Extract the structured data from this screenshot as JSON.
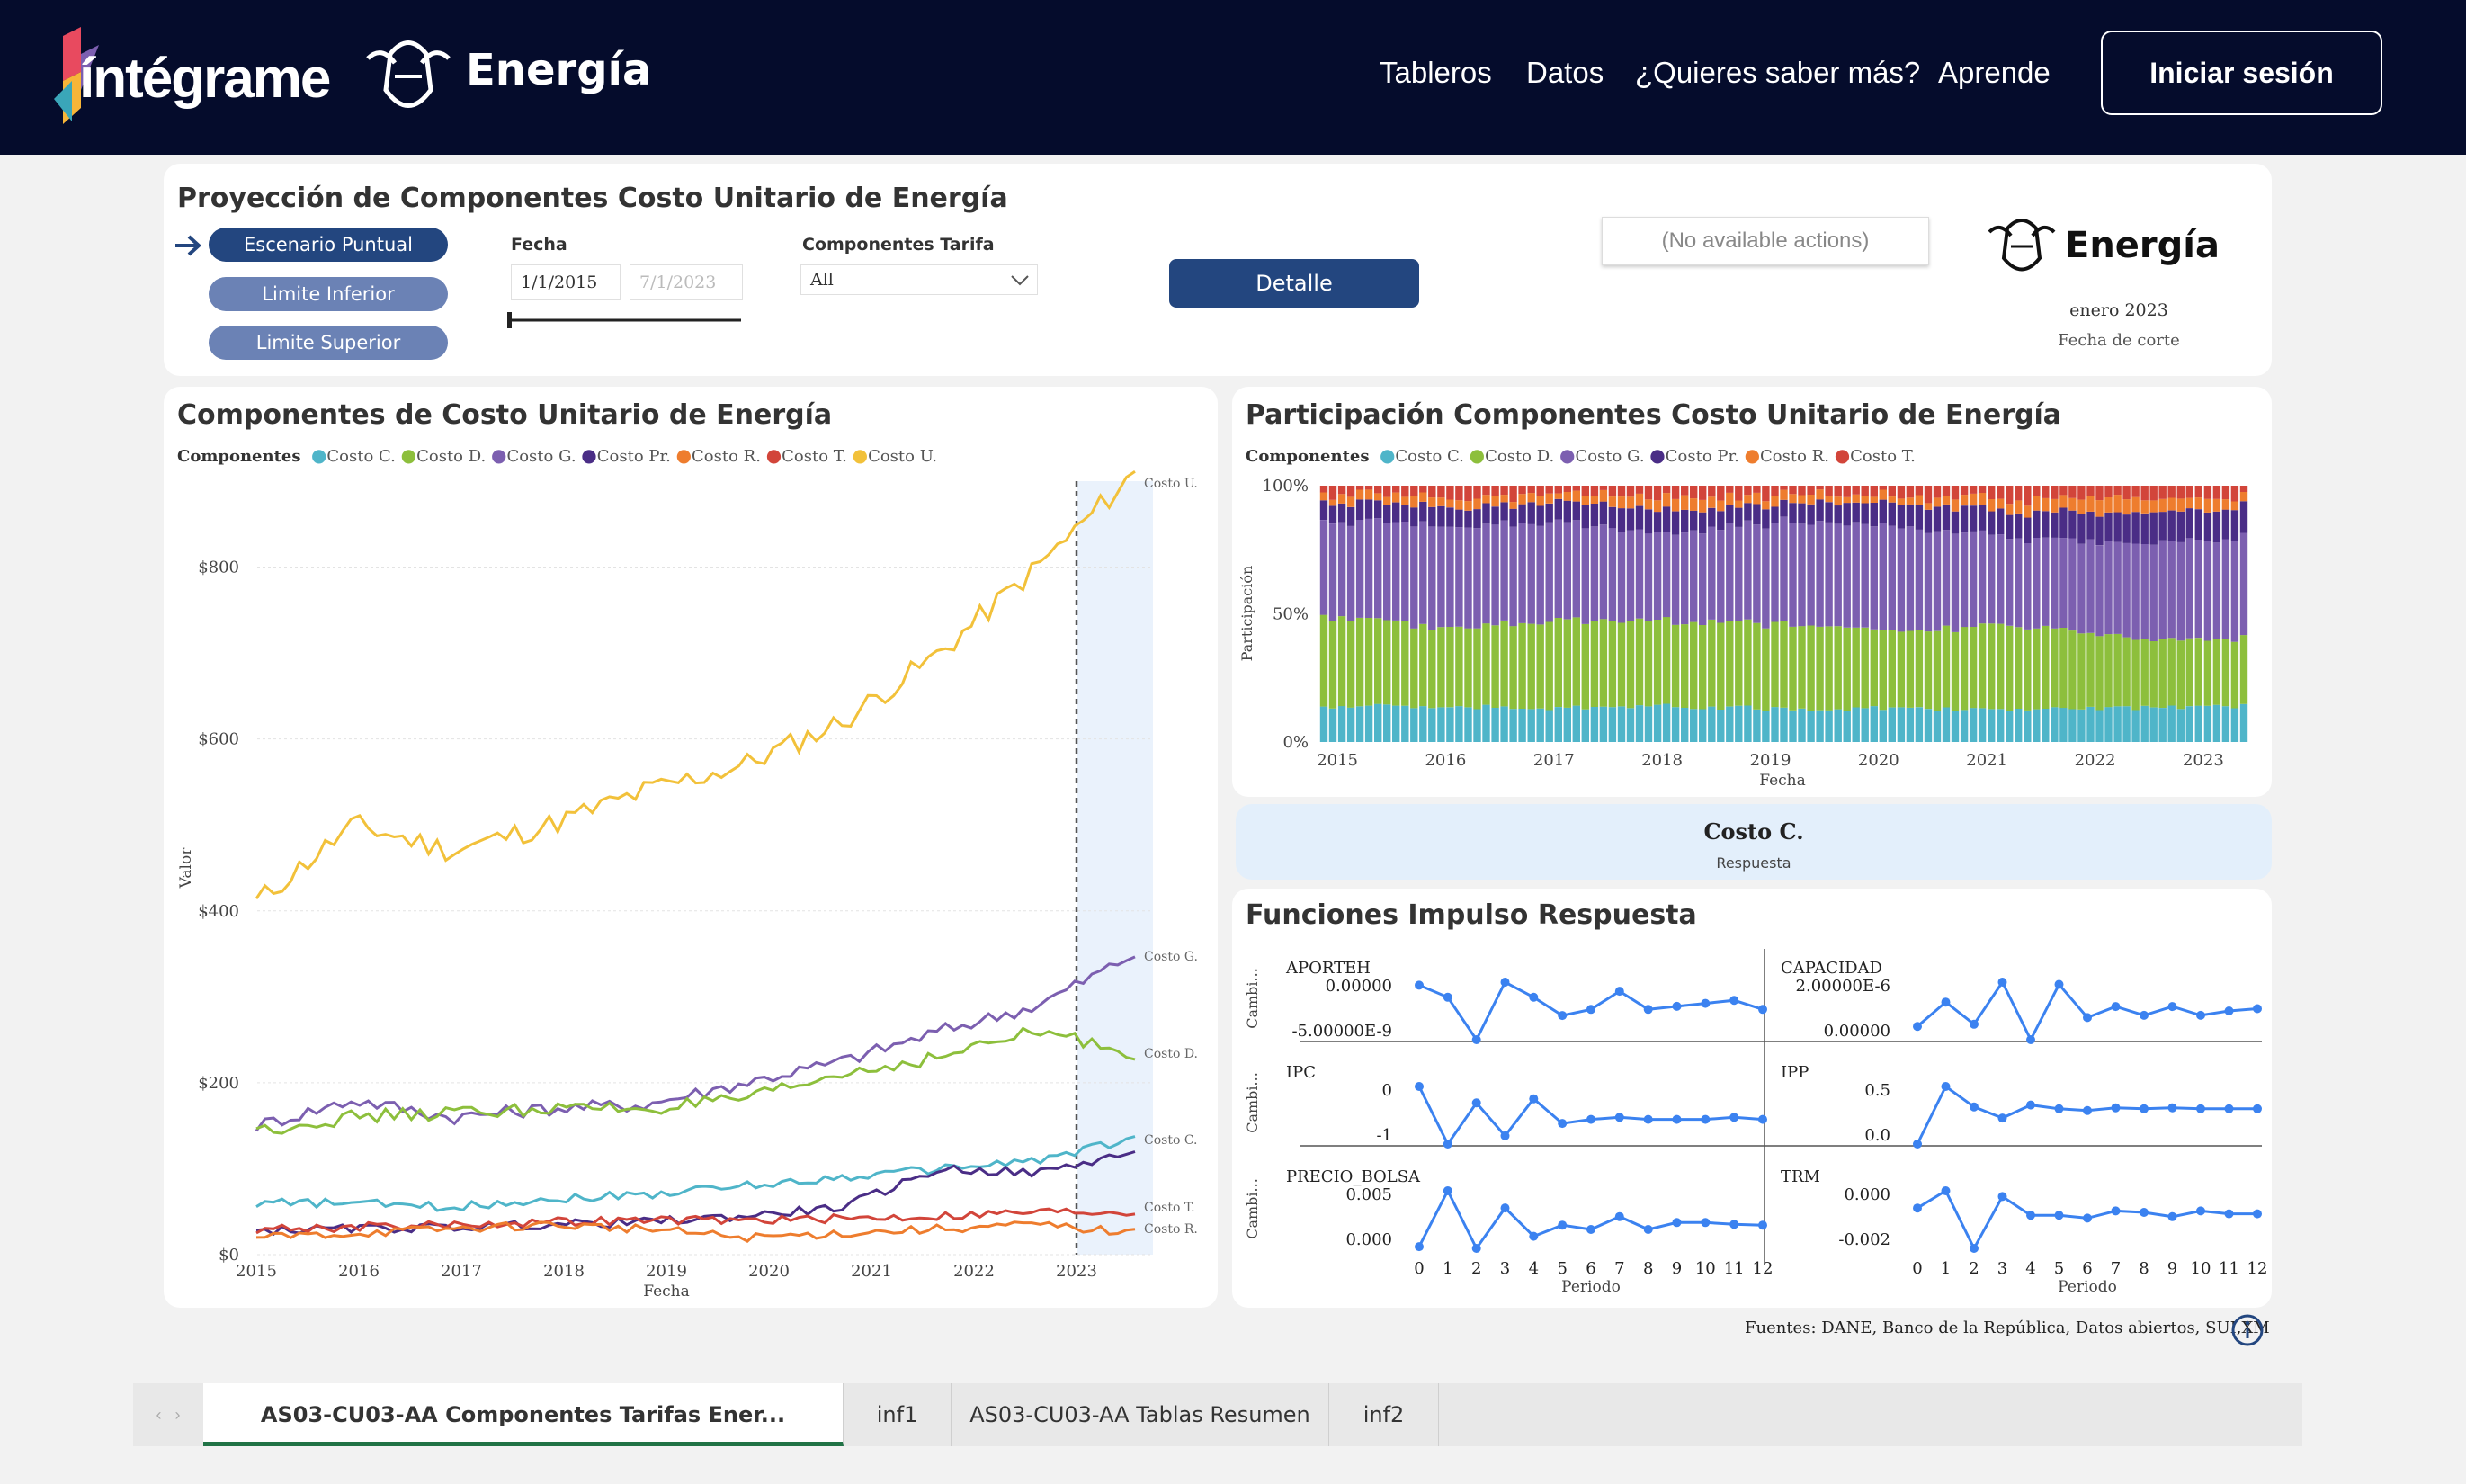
{
  "nav": {
    "logo_text": "íntégrame",
    "brand": "Energía",
    "links": [
      "Tableros",
      "Datos",
      "¿Quieres saber más?",
      "Aprende"
    ],
    "login": "Iniciar sesión"
  },
  "controls": {
    "title": "Proyección de Componentes Costo Unitario de Energía",
    "scenarios": [
      "Escenario Puntual",
      "Limite Inferior",
      "Limite Superior"
    ],
    "fecha_label": "Fecha",
    "fecha_from": "1/1/2015",
    "fecha_to": "7/1/2023",
    "componentes_label": "Componentes Tarifa",
    "componentes_value": "All",
    "detalle": "Detalle",
    "no_actions": "(No available actions)",
    "brand": "Energía",
    "fecha_corte_value": "enero 2023",
    "fecha_corte_label": "Fecha de corte"
  },
  "colors": {
    "costo_c": "#4fb5c9",
    "costo_d": "#8dbf3c",
    "costo_g": "#7c5fb0",
    "costo_pr": "#4a2d86",
    "costo_r": "#ee7d2e",
    "costo_t": "#d2453a",
    "costo_u": "#f2c13a",
    "accent": "#23467f",
    "pill_light": "#6b82b5",
    "nav_bg": "#050c2c"
  },
  "line_chart": {
    "title": "Componentes de Costo Unitario de Energía",
    "legend_title": "Componentes",
    "legend": [
      "Costo C.",
      "Costo D.",
      "Costo G.",
      "Costo Pr.",
      "Costo R.",
      "Costo T.",
      "Costo U."
    ],
    "ylabel": "Valor",
    "xlabel": "Fecha",
    "yticks": [
      "$0",
      "$200",
      "$400",
      "$600",
      "$800"
    ],
    "xticks": [
      "2015",
      "2016",
      "2017",
      "2018",
      "2019",
      "2020",
      "2021",
      "2022",
      "2023"
    ],
    "end_labels": [
      "Costo U.",
      "Costo G.",
      "Costo D.",
      "Costo C.",
      "Costo T.",
      "Costo R."
    ]
  },
  "bar_chart": {
    "title": "Participación Componentes Costo Unitario de Energía",
    "legend_title": "Componentes",
    "legend": [
      "Costo C.",
      "Costo D.",
      "Costo G.",
      "Costo Pr.",
      "Costo R.",
      "Costo T."
    ],
    "ylabel": "Participación",
    "xlabel": "Fecha",
    "yticks": [
      "0%",
      "50%",
      "100%"
    ],
    "xticks": [
      "2015",
      "2016",
      "2017",
      "2018",
      "2019",
      "2020",
      "2021",
      "2022",
      "2023"
    ]
  },
  "selected": {
    "name": "Costo C.",
    "sub": "Respuesta"
  },
  "irf": {
    "title": "Funciones Impulso Respuesta",
    "ylabel": "Cambi...",
    "xlabel": "Periodo",
    "periods": [
      "0",
      "1",
      "2",
      "3",
      "4",
      "5",
      "6",
      "7",
      "8",
      "9",
      "10",
      "11",
      "12"
    ],
    "panels": [
      {
        "name": "APORTEH",
        "ticks": [
          "0.00000",
          "-5.00000E-9"
        ]
      },
      {
        "name": "CAPACIDAD",
        "ticks": [
          "2.00000E-6",
          "0.00000"
        ]
      },
      {
        "name": "IPC",
        "ticks": [
          "0",
          "-1"
        ]
      },
      {
        "name": "IPP",
        "ticks": [
          "0.5",
          "0.0"
        ]
      },
      {
        "name": "PRECIO_BOLSA",
        "ticks": [
          "0.005",
          "0.000"
        ]
      },
      {
        "name": "TRM",
        "ticks": [
          "0.000",
          "-0.002"
        ]
      }
    ]
  },
  "footer": {
    "sources": "Fuentes: DANE, Banco de la República, Datos abiertos, SUI,XM"
  },
  "tabs": [
    "AS03-CU03-AA Componentes Tarifas Ener...",
    "inf1",
    "AS03-CU03-AA Tablas Resumen",
    "inf2"
  ],
  "chart_data": [
    {
      "type": "line",
      "title": "Componentes de Costo Unitario de Energía",
      "xlabel": "Fecha",
      "ylabel": "Valor",
      "ylim": [
        0,
        900
      ],
      "x": [
        "2015",
        "2016",
        "2017",
        "2018",
        "2019",
        "2020",
        "2021",
        "2022",
        "2023",
        "2023-07"
      ],
      "series": [
        {
          "name": "Costo U.",
          "values": [
            410,
            500,
            470,
            500,
            540,
            570,
            620,
            700,
            800,
            910
          ]
        },
        {
          "name": "Costo G.",
          "values": [
            150,
            180,
            160,
            170,
            175,
            200,
            225,
            260,
            290,
            350
          ]
        },
        {
          "name": "Costo D.",
          "values": [
            145,
            160,
            165,
            170,
            170,
            180,
            210,
            230,
            260,
            235
          ]
        },
        {
          "name": "Costo C.",
          "values": [
            60,
            60,
            55,
            65,
            70,
            80,
            90,
            100,
            110,
            135
          ]
        },
        {
          "name": "Costo Pr.",
          "values": [
            28,
            30,
            32,
            35,
            38,
            45,
            55,
            100,
            95,
            120
          ]
        },
        {
          "name": "Costo T.",
          "values": [
            30,
            32,
            35,
            38,
            40,
            40,
            42,
            45,
            50,
            50
          ]
        },
        {
          "name": "Costo R.",
          "values": [
            20,
            25,
            30,
            35,
            30,
            20,
            25,
            30,
            35,
            25
          ]
        }
      ]
    },
    {
      "type": "bar",
      "title": "Participación Componentes Costo Unitario de Energía",
      "xlabel": "Fecha",
      "ylabel": "Participación",
      "ylim": [
        0,
        100
      ],
      "stacked": true,
      "categories": [
        "2015",
        "2016",
        "2017",
        "2018",
        "2019",
        "2020",
        "2021",
        "2022",
        "2023"
      ],
      "series": [
        {
          "name": "Costo C.",
          "values": [
            14,
            14,
            13,
            14,
            13,
            13,
            13,
            13,
            14
          ]
        },
        {
          "name": "Costo D.",
          "values": [
            35,
            31,
            34,
            33,
            33,
            30,
            33,
            27,
            26
          ]
        },
        {
          "name": "Costo G.",
          "values": [
            37,
            40,
            38,
            34,
            40,
            41,
            34,
            37,
            39
          ]
        },
        {
          "name": "Costo Pr.",
          "values": [
            7,
            7,
            8,
            9,
            7,
            9,
            10,
            12,
            12
          ]
        },
        {
          "name": "Costo R.",
          "values": [
            3,
            4,
            3,
            5,
            3,
            3,
            5,
            6,
            4
          ]
        },
        {
          "name": "Costo T.",
          "values": [
            4,
            4,
            4,
            5,
            4,
            4,
            5,
            5,
            5
          ]
        }
      ]
    },
    {
      "type": "line",
      "title": "APORTEH",
      "x": [
        "0",
        "1",
        "2",
        "3",
        "4",
        "5",
        "6",
        "7",
        "8",
        "9",
        "10",
        "11",
        "12"
      ],
      "values": [
        0,
        -2e-09,
        -9e-09,
        5e-10,
        -2e-09,
        -5e-09,
        -4e-09,
        -1e-09,
        -4e-09,
        -3.5e-09,
        -3e-09,
        -2.5e-09,
        -4e-09
      ]
    },
    {
      "type": "line",
      "title": "CAPACIDAD",
      "x": [
        "0",
        "1",
        "2",
        "3",
        "4",
        "5",
        "6",
        "7",
        "8",
        "9",
        "10",
        "11",
        "12"
      ],
      "values": [
        0,
        1.1e-06,
        1e-07,
        2e-06,
        -6e-07,
        1.9e-06,
        4e-07,
        9e-07,
        5e-07,
        9e-07,
        5e-07,
        7e-07,
        8e-07
      ]
    },
    {
      "type": "line",
      "title": "IPC",
      "x": [
        "0",
        "1",
        "2",
        "3",
        "4",
        "5",
        "6",
        "7",
        "8",
        "9",
        "10",
        "11",
        "12"
      ],
      "values": [
        0,
        -1.4,
        -0.4,
        -1.2,
        -0.3,
        -0.9,
        -0.8,
        -0.75,
        -0.8,
        -0.8,
        -0.8,
        -0.75,
        -0.8
      ]
    },
    {
      "type": "line",
      "title": "IPP",
      "x": [
        "0",
        "1",
        "2",
        "3",
        "4",
        "5",
        "6",
        "7",
        "8",
        "9",
        "10",
        "11",
        "12"
      ],
      "values": [
        0,
        0.62,
        0.4,
        0.28,
        0.42,
        0.38,
        0.36,
        0.39,
        0.38,
        0.39,
        0.38,
        0.38,
        0.38
      ]
    },
    {
      "type": "line",
      "title": "PRECIO_BOLSA",
      "x": [
        "0",
        "1",
        "2",
        "3",
        "4",
        "5",
        "6",
        "7",
        "8",
        "9",
        "10",
        "11",
        "12"
      ],
      "values": [
        0,
        0.0065,
        -0.0002,
        0.0045,
        0.0012,
        0.0025,
        0.002,
        0.0035,
        0.002,
        0.0028,
        0.0028,
        0.0026,
        0.0025
      ]
    },
    {
      "type": "line",
      "title": "TRM",
      "x": [
        "0",
        "1",
        "2",
        "3",
        "4",
        "5",
        "6",
        "7",
        "8",
        "9",
        "10",
        "11",
        "12"
      ],
      "values": [
        0,
        0.0012,
        -0.0028,
        0.0008,
        -0.0005,
        -0.0005,
        -0.0007,
        -0.0002,
        -0.0003,
        -0.0006,
        -0.0002,
        -0.0004,
        -0.0004
      ]
    }
  ]
}
